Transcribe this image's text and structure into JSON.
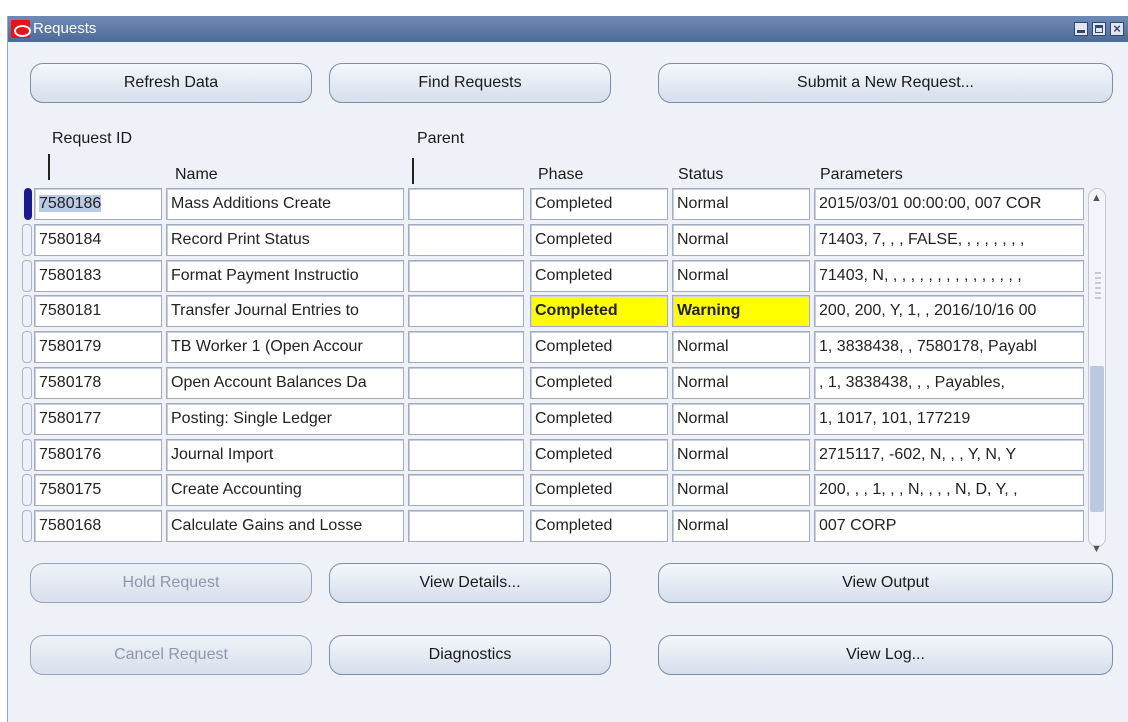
{
  "window": {
    "title": "Requests"
  },
  "toolbar": {
    "refresh_label": "Refresh Data",
    "find_label": "Find Requests",
    "submit_label": "Submit a New Request..."
  },
  "columns": {
    "request_id": "Request ID",
    "parent": "Parent",
    "name": "Name",
    "phase": "Phase",
    "status": "Status",
    "parameters": "Parameters"
  },
  "rows": [
    {
      "id": "7580186",
      "name": "Mass Additions Create",
      "parent": "",
      "phase": "Completed",
      "status": "Normal",
      "params": "2015/03/01 00:00:00, 007 COR"
    },
    {
      "id": "7580184",
      "name": "Record Print Status",
      "parent": "",
      "phase": "Completed",
      "status": "Normal",
      "params": "71403, 7, , , FALSE, , , , , , , ,"
    },
    {
      "id": "7580183",
      "name": "Format Payment Instructio",
      "parent": "",
      "phase": "Completed",
      "status": "Normal",
      "params": "71403, N, , , , , , , , , , , , , , , ,"
    },
    {
      "id": "7580181",
      "name": "Transfer Journal Entries to",
      "parent": "",
      "phase": "Completed",
      "status": "Warning",
      "params": "200, 200, Y, 1, , 2016/10/16 00"
    },
    {
      "id": "7580179",
      "name": "TB Worker 1 (Open Accour",
      "parent": "",
      "phase": "Completed",
      "status": "Normal",
      "params": "1, 3838438, , 7580178, Payabl"
    },
    {
      "id": "7580178",
      "name": "Open Account Balances Da",
      "parent": "",
      "phase": "Completed",
      "status": "Normal",
      "params": ", 1, 3838438, , , Payables,"
    },
    {
      "id": "7580177",
      "name": "Posting: Single Ledger",
      "parent": "",
      "phase": "Completed",
      "status": "Normal",
      "params": "1, 1017, 101, 177219"
    },
    {
      "id": "7580176",
      "name": "Journal Import",
      "parent": "",
      "phase": "Completed",
      "status": "Normal",
      "params": "2715117, -602, N, , , Y, N, Y"
    },
    {
      "id": "7580175",
      "name": "Create Accounting",
      "parent": "",
      "phase": "Completed",
      "status": "Normal",
      "params": "200, , , 1, , , N, , , , N, D, Y, ,"
    },
    {
      "id": "7580168",
      "name": "Calculate Gains and Losse",
      "parent": "",
      "phase": "Completed",
      "status": "Normal",
      "params": "007 CORP"
    }
  ],
  "actions": {
    "hold_label": "Hold Request",
    "view_details_label": "View Details...",
    "view_output_label": "View Output",
    "cancel_label": "Cancel Request",
    "diagnostics_label": "Diagnostics",
    "view_log_label": "View Log..."
  },
  "colors": {
    "warning_highlight": "#ffff00",
    "titlebar": "#5b77a3"
  }
}
